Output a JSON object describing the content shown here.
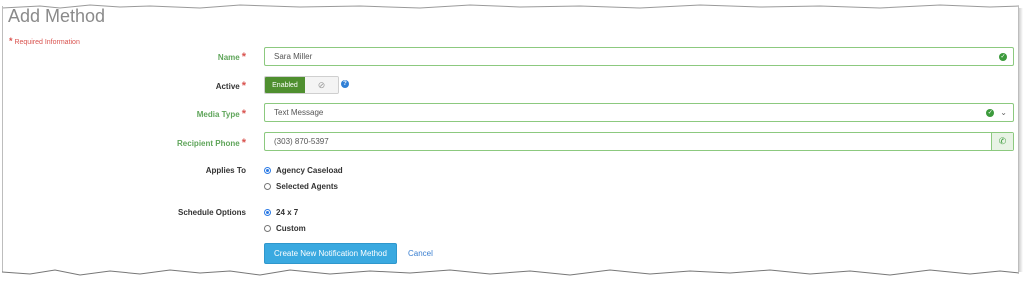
{
  "page": {
    "title": "Add Method",
    "required_note": "Required Information"
  },
  "form": {
    "name": {
      "label": "Name",
      "value": "Sara Miller"
    },
    "active": {
      "label": "Active",
      "on_label": "Enabled"
    },
    "media_type": {
      "label": "Media Type",
      "value": "Text Message"
    },
    "recipient_phone": {
      "label": "Recipient Phone",
      "value": "(303) 870-5397"
    },
    "applies_to": {
      "label": "Applies To",
      "options": [
        "Agency Caseload",
        "Selected Agents"
      ],
      "selected": "Agency Caseload"
    },
    "schedule_options": {
      "label": "Schedule Options",
      "options": [
        "24 x 7",
        "Custom"
      ],
      "selected": "24 x 7"
    }
  },
  "actions": {
    "submit_label": "Create New Notification Method",
    "cancel_label": "Cancel"
  },
  "colors": {
    "label_green": "#5fa55a",
    "required_red": "#d9534f",
    "primary_blue": "#3aa9e0",
    "toggle_green": "#4f8f2f"
  }
}
